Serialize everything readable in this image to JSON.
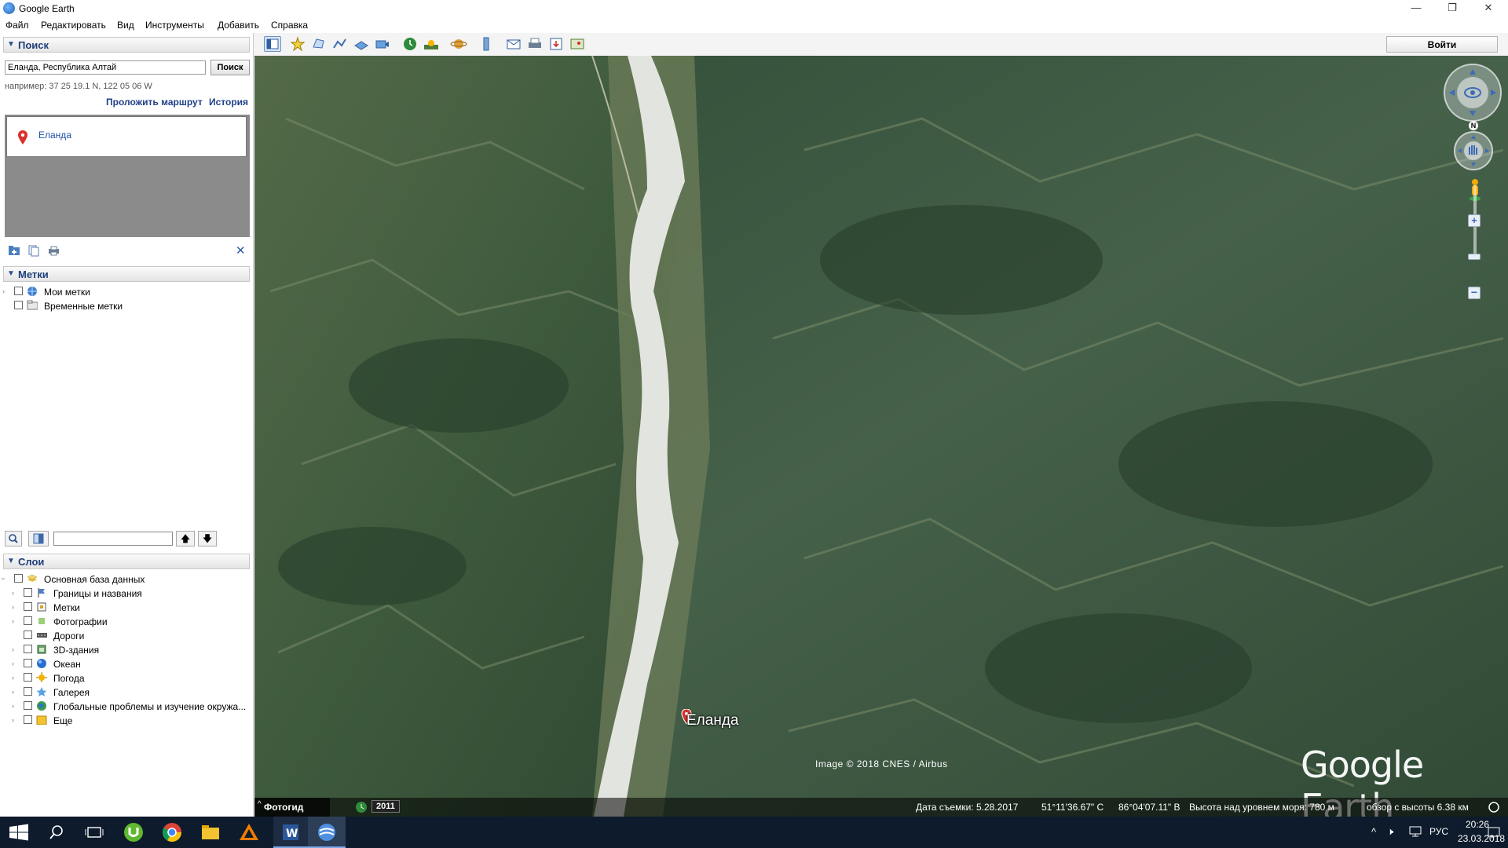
{
  "window": {
    "title": "Google Earth",
    "minimize": "—",
    "restore": "❐",
    "close": "✕"
  },
  "menu": [
    "Файл",
    "Редактировать",
    "Вид",
    "Инструменты",
    "Добавить",
    "Справка"
  ],
  "search": {
    "header": "Поиск",
    "value": "Еланда, Республика Алтай",
    "button": "Поиск",
    "hint": "например: 37 25 19.1 N, 122 05 06 W",
    "route_link": "Проложить маршрут",
    "history_link": "История",
    "result": "Еланда"
  },
  "places": {
    "header": "Метки",
    "items": [
      "Мои метки",
      "Временные метки"
    ]
  },
  "layers": {
    "header": "Слои",
    "root": "Основная база данных",
    "items": [
      "Границы и названия",
      "Метки",
      "Фотографии",
      "Дороги",
      "3D-здания",
      "Океан",
      "Погода",
      "Галерея",
      "Глобальные проблемы и изучение окружа...",
      "Еще"
    ]
  },
  "toolbar": {
    "login": "Войти"
  },
  "map": {
    "placemark_label": "Еланда",
    "attribution": "Image © 2018 CNES / Airbus",
    "watermark": "Google Earth",
    "compass_n": "N",
    "photo_guide": "Фотогид",
    "year": "2011",
    "imagery_date": "Дата съемки: 5.28.2017",
    "lat": "51°11'36.67\" С",
    "lon": "86°04'07.11\" В",
    "elevation": "Высота над уровнем моря:   780 м",
    "eye_alt": "обзор с высоты    6.38 км"
  },
  "taskbar": {
    "lang": "РУС",
    "time": "20:26",
    "date": "23.03.2018"
  },
  "colors": {
    "header_text": "#1e3f7a",
    "taskbar": "#0e1b2c",
    "river": "#e2e4df"
  }
}
